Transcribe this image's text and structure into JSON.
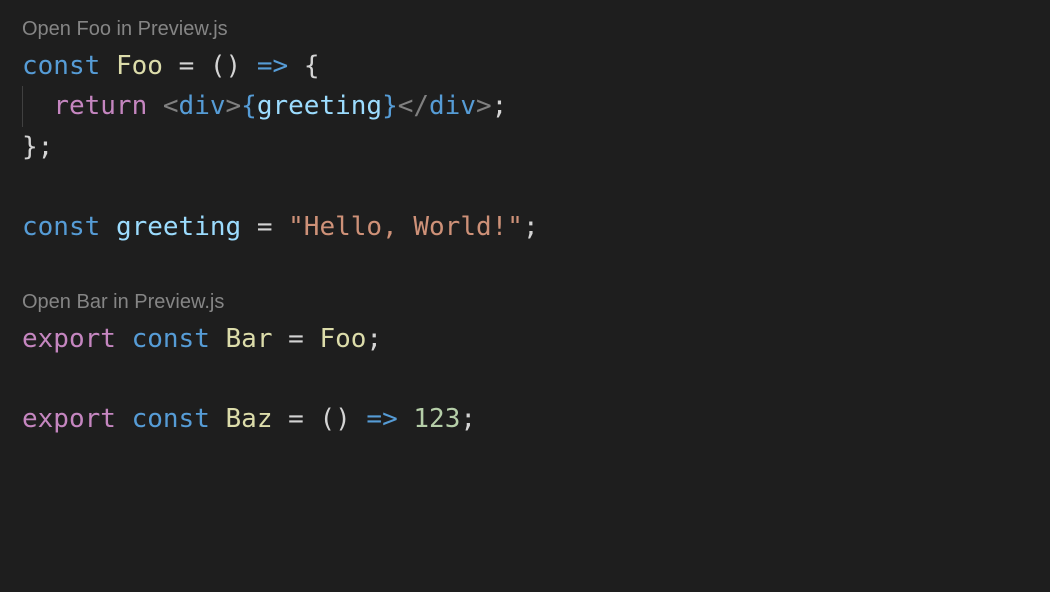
{
  "codelens": {
    "foo": "Open Foo in Preview.js",
    "bar": "Open Bar in Preview.js"
  },
  "tokens": {
    "const": "const",
    "export": "export",
    "return": "return",
    "foo": "Foo",
    "bar": "Bar",
    "baz": "Baz",
    "greeting_id": "greeting",
    "greeting_ref": "greeting",
    "eq": "=",
    "arrow": "=>",
    "lparen": "(",
    "rparen": ")",
    "lbrace": "{",
    "rbrace": "}",
    "semi": ";",
    "lt": "<",
    "gt": ">",
    "ltslash": "</",
    "div": "div",
    "string_val": "\"Hello, World!\"",
    "num_val": "123",
    "sp": " ",
    "indent": "  "
  }
}
